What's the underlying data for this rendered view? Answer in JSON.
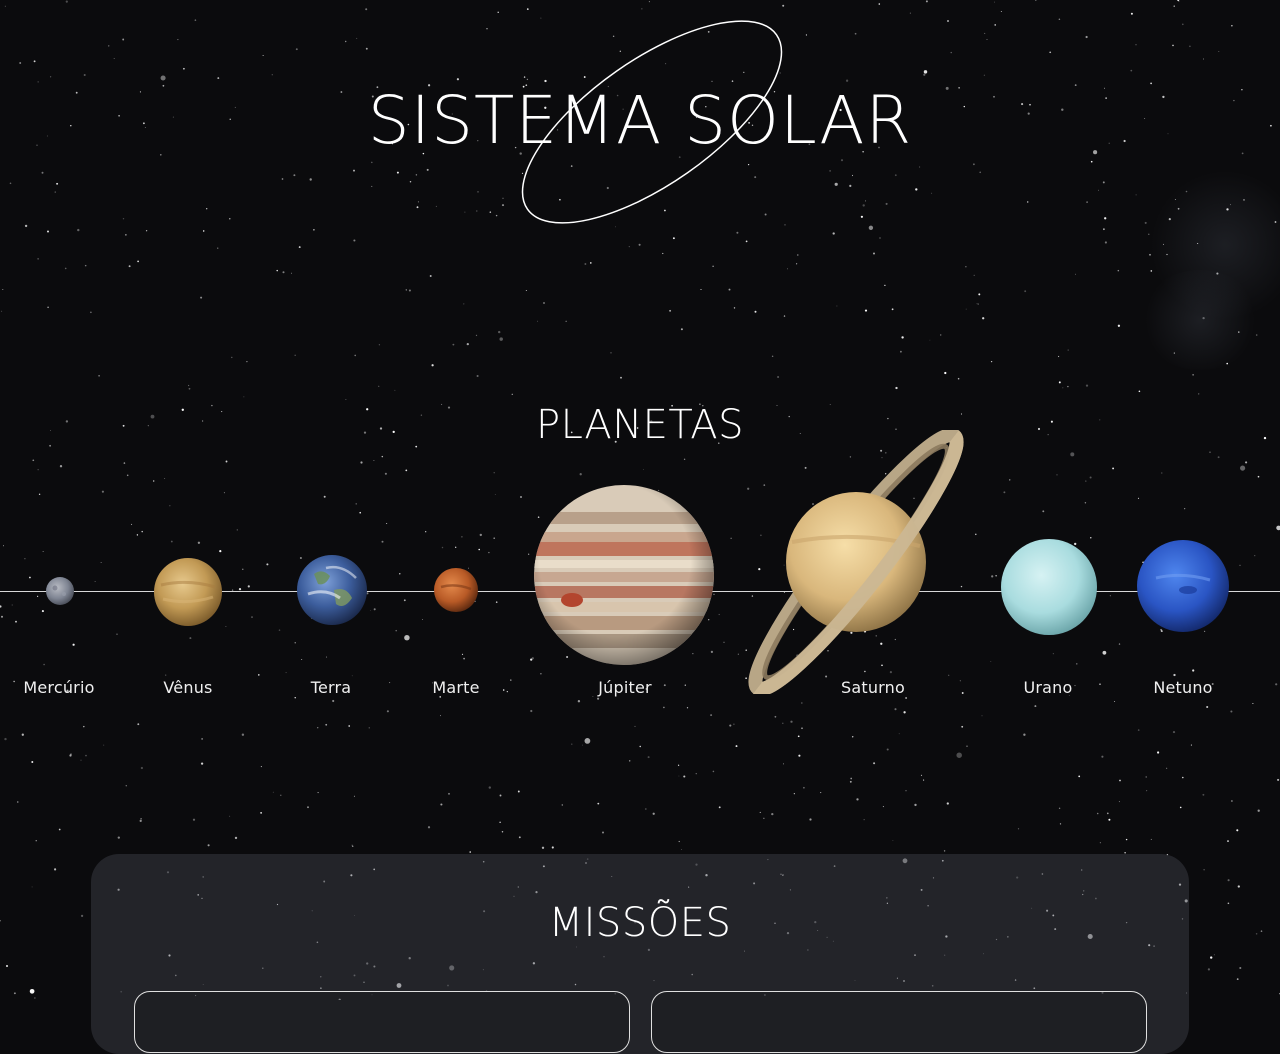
{
  "header": {
    "title": "SISTEMA SOLAR"
  },
  "planets": {
    "heading": "PLANETAS",
    "items": [
      {
        "name": "Mercúrio",
        "color": "#8a8f99"
      },
      {
        "name": "Vênus",
        "color": "#c9a463"
      },
      {
        "name": "Terra",
        "color": "#4f6fa8"
      },
      {
        "name": "Marte",
        "color": "#c76a35"
      },
      {
        "name": "Júpiter",
        "color": "#d6c3ab"
      },
      {
        "name": "Saturno",
        "color": "#e3c88e"
      },
      {
        "name": "Urano",
        "color": "#b7e3e6"
      },
      {
        "name": "Netuno",
        "color": "#2f5fd0"
      }
    ]
  },
  "missions": {
    "heading": "MISSÕES"
  },
  "colors": {
    "background": "#0b0b0d",
    "text": "#ffffff",
    "panel": "#3a3c44"
  }
}
